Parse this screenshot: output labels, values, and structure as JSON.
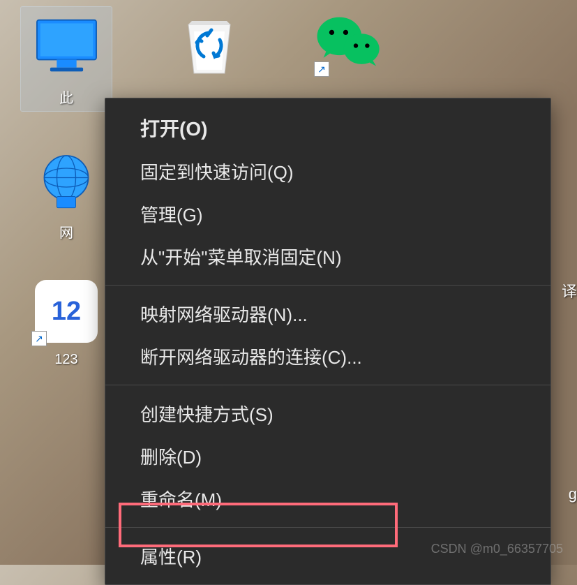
{
  "desktop": {
    "icons": {
      "this_pc": {
        "label": "此"
      },
      "network": {
        "label": "网"
      },
      "app123": {
        "label": "123",
        "icon_text": "12"
      },
      "recycle_bin": {
        "label": ""
      },
      "wechat": {
        "label": ""
      }
    },
    "partial_right_1": "译",
    "partial_right_2": "g"
  },
  "context_menu": {
    "items": [
      {
        "label": "打开(O)",
        "bold": true
      },
      {
        "label": "固定到快速访问(Q)"
      },
      {
        "label": "管理(G)"
      },
      {
        "label": "从\"开始\"菜单取消固定(N)"
      }
    ],
    "group2": [
      {
        "label": "映射网络驱动器(N)..."
      },
      {
        "label": "断开网络驱动器的连接(C)..."
      }
    ],
    "group3": [
      {
        "label": "创建快捷方式(S)"
      },
      {
        "label": "删除(D)"
      },
      {
        "label": "重命名(M)"
      }
    ],
    "group4": [
      {
        "label": "属性(R)"
      }
    ]
  },
  "watermark": "CSDN @m0_66357705"
}
